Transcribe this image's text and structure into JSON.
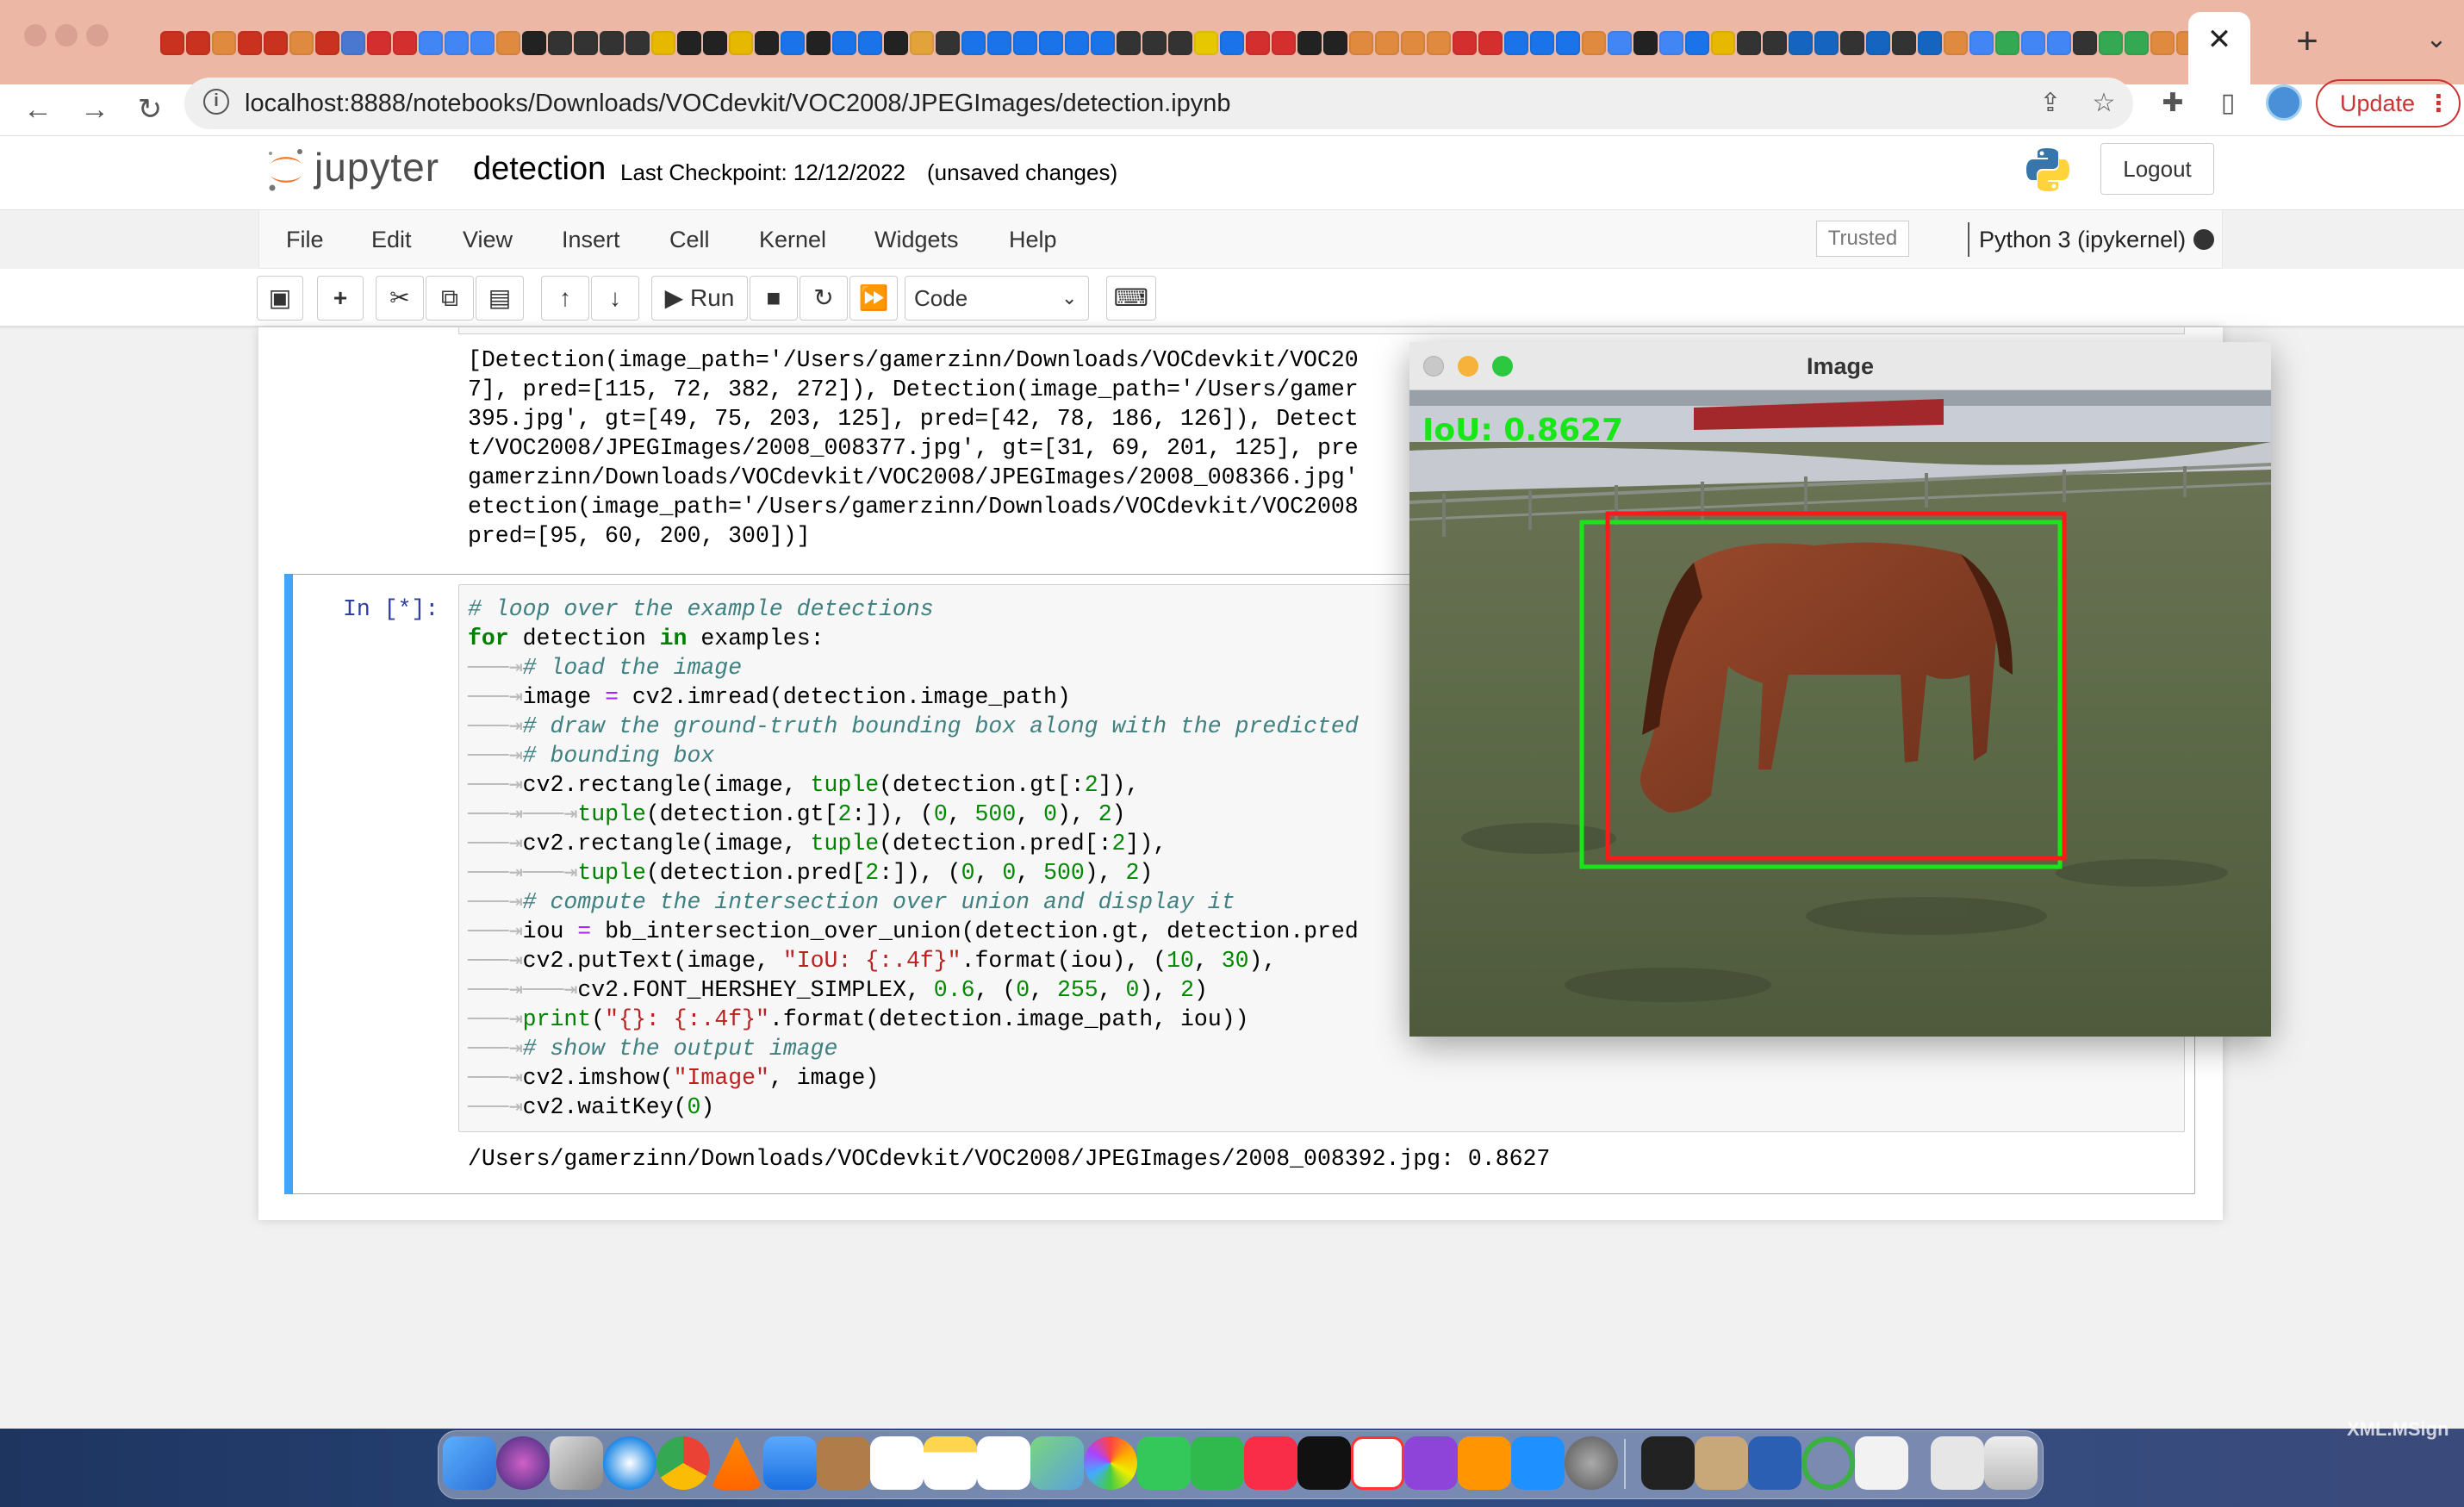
{
  "browser": {
    "url": "localhost:8888/notebooks/Downloads/VOCdevkit/VOC2008/JPEGImages/detection.ipynb",
    "update_label": "Update",
    "favicon_colors": [
      "#c8321e",
      "#c8321e",
      "#e08a40",
      "#c8321e",
      "#c8321e",
      "#e08a40",
      "#c8321e",
      "#4a78d0",
      "#d32f2f",
      "#d32f2f",
      "#4285f4",
      "#4285f4",
      "#4285f4",
      "#e08a40",
      "#222222",
      "#333333",
      "#333333",
      "#333333",
      "#333333",
      "#e6b800",
      "#222222",
      "#222222",
      "#e6b800",
      "#222222",
      "#1a73e8",
      "#222222",
      "#1a73e8",
      "#1a73e8",
      "#222222",
      "#e2a33a",
      "#333333",
      "#1a73e8",
      "#1a73e8",
      "#1a73e8",
      "#1a73e8",
      "#1a73e8",
      "#1a73e8",
      "#333333",
      "#333333",
      "#333333",
      "#e6c800",
      "#1a73e8",
      "#d32f2f",
      "#d32f2f",
      "#222222",
      "#222222",
      "#e08a40",
      "#e08a40",
      "#e08a40",
      "#e08a40",
      "#d32f2f",
      "#d32f2f",
      "#1a73e8",
      "#1a73e8",
      "#1a73e8",
      "#e08a40",
      "#4285f4",
      "#222222",
      "#4285f4",
      "#1a73e8",
      "#e6b800",
      "#333333",
      "#333333",
      "#1565c0",
      "#1565c0",
      "#333333",
      "#1565c0",
      "#333333",
      "#1565c0",
      "#e08a40",
      "#4285f4",
      "#34a853",
      "#4285f4",
      "#4285f4",
      "#333333",
      "#34a853",
      "#34a853",
      "#e08a40",
      "#e08a40",
      "#e08a40"
    ],
    "tab_close_glyph": "✕",
    "new_tab_glyph": "+"
  },
  "jupyter": {
    "logo_text": "jupyter",
    "notebook_title": "detection",
    "checkpoint": "Last Checkpoint: 12/12/2022",
    "unsaved": "(unsaved changes)",
    "logout_label": "Logout",
    "menus": [
      "File",
      "Edit",
      "View",
      "Insert",
      "Cell",
      "Kernel",
      "Widgets",
      "Help"
    ],
    "trusted_label": "Trusted",
    "kernel_name": "Python 3 (ipykernel)",
    "run_label": "Run",
    "cell_type": "Code"
  },
  "previous_output": [
    "[Detection(image_path='/Users/gamerzinn/Downloads/VOCdevkit/VOC20",
    "7], pred=[115, 72, 382, 272]), Detection(image_path='/Users/gamer",
    "395.jpg', gt=[49, 75, 203, 125], pred=[42, 78, 186, 126]), Detect",
    "t/VOC2008/JPEGImages/2008_008377.jpg', gt=[31, 69, 201, 125], pre",
    "gamerzinn/Downloads/VOCdevkit/VOC2008/JPEGImages/2008_008366.jpg'",
    "etection(image_path='/Users/gamerzinn/Downloads/VOCdevkit/VOC2008",
    "pred=[95, 60, 200, 300])]"
  ],
  "cell": {
    "prompt": "In [*]:",
    "stdout": "/Users/gamerzinn/Downloads/VOCdevkit/VOC2008/JPEGImages/2008_008392.jpg: 0.8627"
  },
  "image_window": {
    "title": "Image",
    "overlay_text": "IoU: 0.8627",
    "gt_box_color": "#19e619",
    "pred_box_color": "#ff1a1a"
  },
  "desktop": {
    "corner_text": "XML.MSign"
  }
}
